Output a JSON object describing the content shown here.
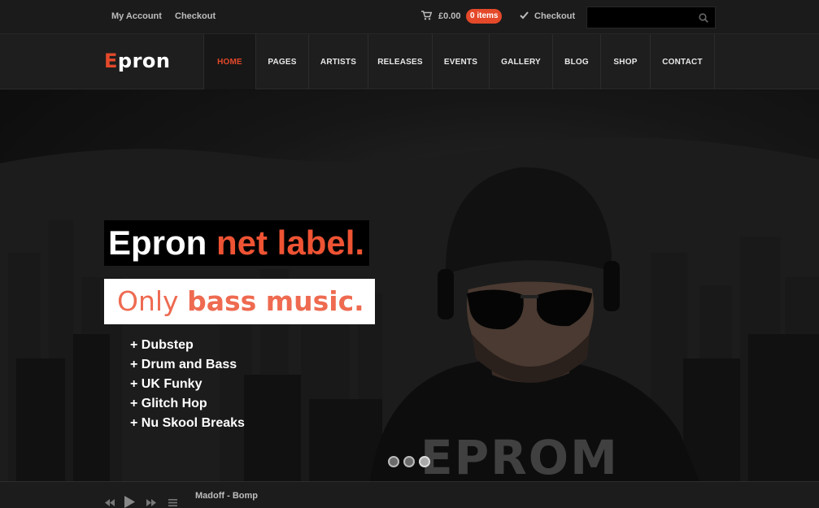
{
  "topbar": {
    "my_account": "My Account",
    "checkout": "Checkout",
    "cart_amount": "£0.00",
    "cart_items": "0 items",
    "checkout_right": "Checkout",
    "search_placeholder": ""
  },
  "brand": {
    "logo_accent": "E",
    "logo_rest": "pron"
  },
  "nav": {
    "items": [
      {
        "label": "HOME",
        "active": true
      },
      {
        "label": "PAGES"
      },
      {
        "label": "ARTISTS"
      },
      {
        "label": "RELEASES"
      },
      {
        "label": "EVENTS"
      },
      {
        "label": "GALLERY"
      },
      {
        "label": "BLOG"
      },
      {
        "label": "SHOP"
      },
      {
        "label": "CONTACT"
      }
    ]
  },
  "hero": {
    "headline_part1": "Epron",
    "headline_part2": "net label.",
    "sub_part1": "Only",
    "sub_part2": "bass music.",
    "genres": [
      "+ Dubstep",
      "+ Drum and Bass",
      "+ UK Funky",
      "+ Glitch Hop",
      "+ Nu Skool Breaks"
    ],
    "shirt_logo": "EPROM",
    "slides": 3,
    "active_slide": 3
  },
  "player": {
    "track": "Madoff - Bomp"
  },
  "colors": {
    "accent": "#e4492a",
    "bg_dark": "#1b1b1b"
  },
  "icons": [
    "cart-icon",
    "check-icon",
    "search-icon",
    "prev-icon",
    "play-icon",
    "next-icon",
    "playlist-icon"
  ]
}
